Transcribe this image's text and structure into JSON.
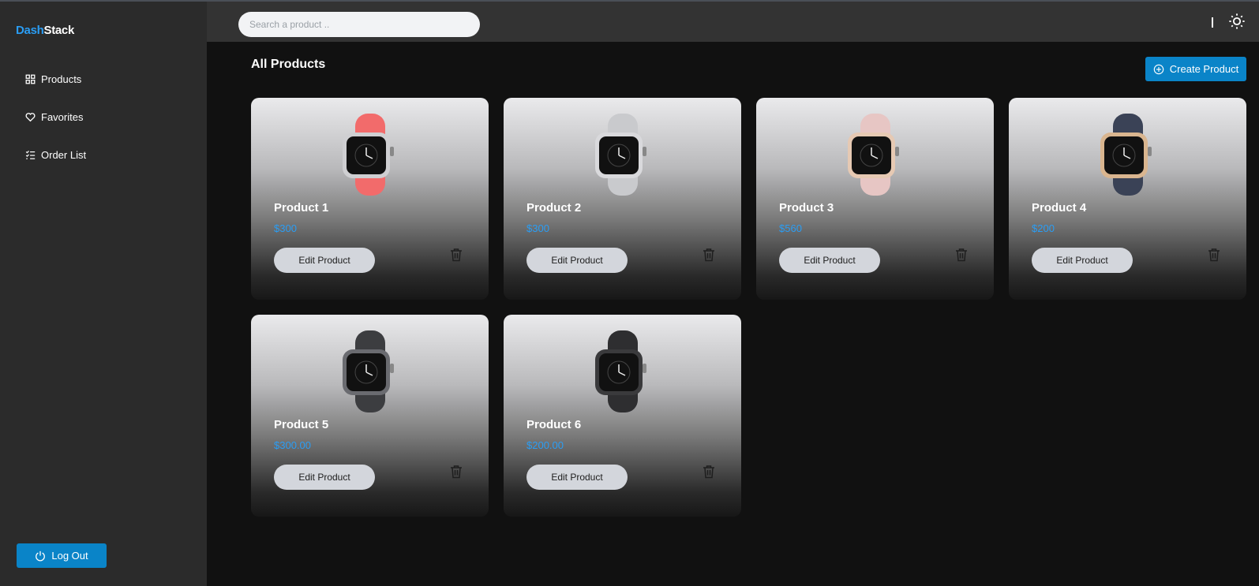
{
  "brand": {
    "accent": "Dash",
    "rest": "Stack",
    "accent_color": "#2a9df4"
  },
  "sidebar": {
    "items": [
      {
        "label": "Products",
        "icon": "grid-icon"
      },
      {
        "label": "Favorites",
        "icon": "heart-icon"
      },
      {
        "label": "Order List",
        "icon": "list-check-icon"
      }
    ],
    "logout_label": "Log Out"
  },
  "header": {
    "search_placeholder": "Search a product ..",
    "theme_icon": "sun-icon"
  },
  "main": {
    "title": "All Products",
    "create_label": "Create Product",
    "products": [
      {
        "name": "Product 1",
        "price": "$300",
        "edit_label": "Edit Product",
        "band_color": "#f26b6b",
        "face_color": "#cfcfd2"
      },
      {
        "name": "Product 2",
        "price": "$300",
        "edit_label": "Edit Product",
        "band_color": "#c9cacd",
        "face_color": "#d9d9dc"
      },
      {
        "name": "Product 3",
        "price": "$560",
        "edit_label": "Edit Product",
        "band_color": "#e7c6c4",
        "face_color": "#e6c9b3"
      },
      {
        "name": "Product 4",
        "price": "$200",
        "edit_label": "Edit Product",
        "band_color": "#3a4256",
        "face_color": "#d9b58f"
      },
      {
        "name": "Product 5",
        "price": "$300.00",
        "edit_label": "Edit Product",
        "band_color": "#3c3d40",
        "face_color": "#6a6b70"
      },
      {
        "name": "Product 6",
        "price": "$200.00",
        "edit_label": "Edit Product",
        "band_color": "#2e2e30",
        "face_color": "#3a3a3c"
      }
    ]
  },
  "colors": {
    "primary": "#0a84c8",
    "price": "#2a9df4",
    "sidebar_bg": "#2b2b2b",
    "header_bg": "#333333",
    "main_bg": "#111111"
  }
}
